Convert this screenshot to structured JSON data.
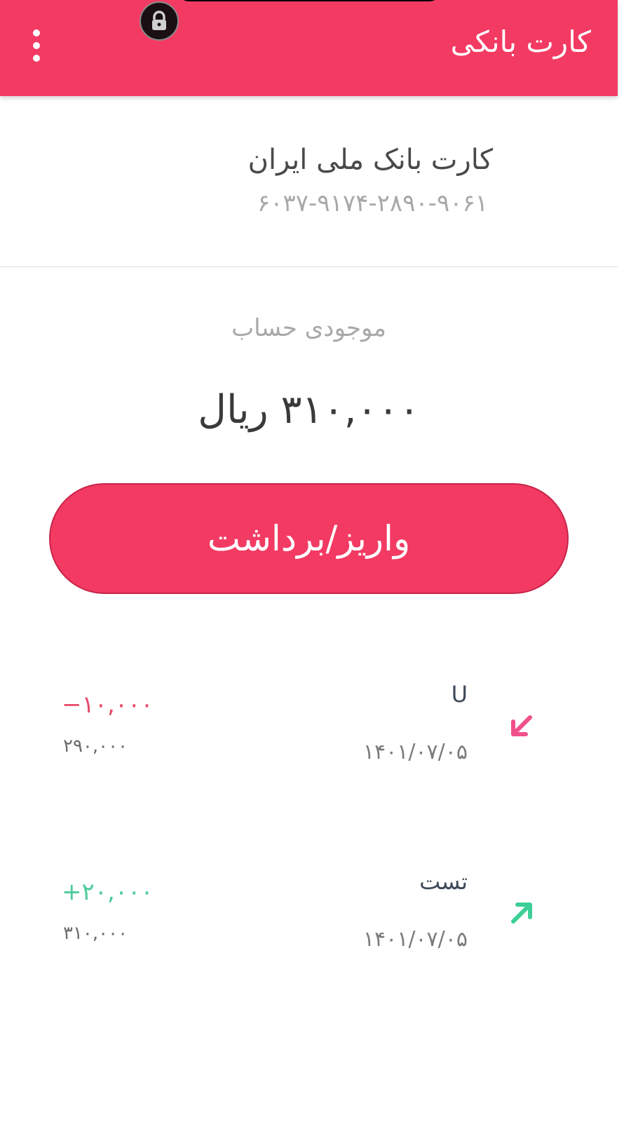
{
  "appbar": {
    "title": "کارت بانکی",
    "menu_icon": "more-vert-icon",
    "brand_color": "#f23a63"
  },
  "status": {
    "lock_icon": "lock-icon"
  },
  "card": {
    "name": "کارت بانک ملی ایران",
    "number": "۶۰۳۷-۹۱۷۴-۲۸۹۰-۹۰۶۱"
  },
  "balance": {
    "label": "موجودی حساب",
    "value": "۳۱۰,۰۰۰ ریال"
  },
  "action": {
    "label": "واریز/برداشت"
  },
  "transactions": [
    {
      "title": "U",
      "date": "۱۴۰۱/۰۷/۰۵",
      "amount": "−۱۰,۰۰۰",
      "balance_after": "۲۹۰,۰۰۰",
      "direction": "withdrawal",
      "icon": "arrow-down-left-icon",
      "color": "#e84a6a"
    },
    {
      "title": "تست",
      "date": "۱۴۰۱/۰۷/۰۵",
      "amount": "+۲۰,۰۰۰",
      "balance_after": "۳۱۰,۰۰۰",
      "direction": "deposit",
      "icon": "arrow-up-right-icon",
      "color": "#4ccb9b"
    }
  ]
}
